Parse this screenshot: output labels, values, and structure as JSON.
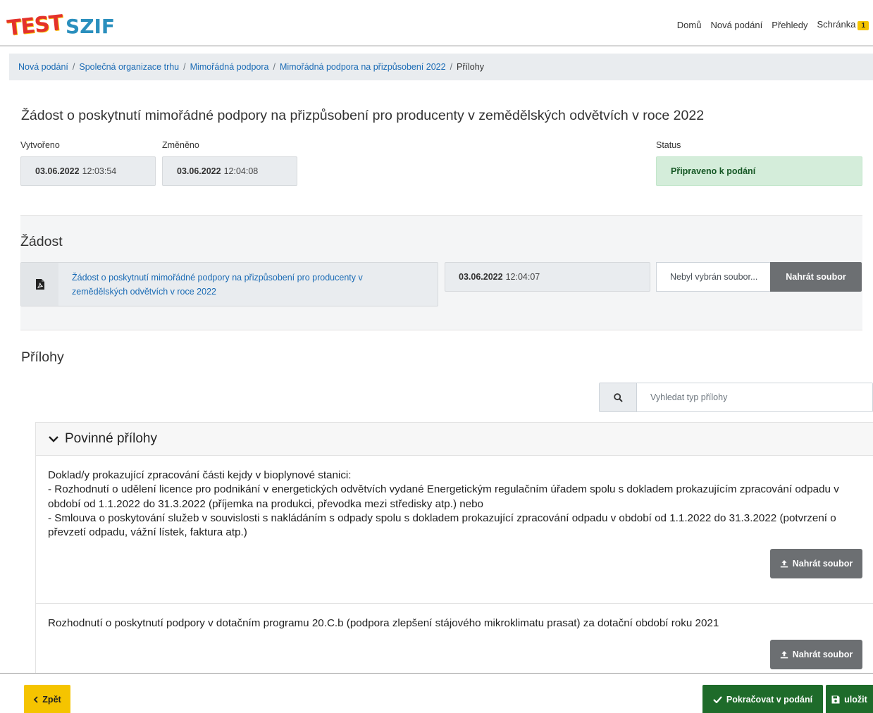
{
  "header": {
    "logo_test": "TEST",
    "logo_szif": "SZIF",
    "nav": [
      "Domů",
      "Nová podání",
      "Přehledy",
      "Schránka"
    ],
    "inbox_count": "1"
  },
  "breadcrumb": {
    "items": [
      "Nová podání",
      "Společná organizace trhu",
      "Mimořádná podpora",
      "Mimořádná podpora na přizpůsobení 2022"
    ],
    "separator": "/",
    "current": "Přílohy"
  },
  "page_title": "Žádost o poskytnutí mimořádné podpory na přizpůsobení pro producenty v zemědělských odvětvích v roce 2022",
  "meta": {
    "created_label": "Vytvořeno",
    "created_date": "03.06.2022",
    "created_time": "12:03:54",
    "changed_label": "Změněno",
    "changed_date": "03.06.2022",
    "changed_time": "12:04:08",
    "status_label": "Status",
    "status_value": "Připraveno k podání"
  },
  "zadost": {
    "title": "Žádost",
    "doc_link": "Žádost o poskytnutí mimořádné podpory na přizpůsobení pro producenty v zemědělských odvětvích v roce 2022",
    "doc_date": "03.06.2022",
    "doc_time": "12:04:07",
    "file_placeholder": "Nebyl vybrán soubor...",
    "upload_label": "Nahrát soubor"
  },
  "prilohy": {
    "title": "Přílohy",
    "search_placeholder": "Vyhledat typ přílohy",
    "panel_title": "Povinné přílohy",
    "items": [
      {
        "lines": [
          "Doklad/y prokazující zpracování části kejdy v bioplynové stanici:",
          "- Rozhodnutí o udělení licence pro podnikání v energetických odvětvích vydané Energetickým regulačním úřadem spolu s dokladem prokazujícím zpracování odpadu v období od 1.1.2022 do 31.3.2022 (příjemka na produkci, převodka mezi středisky atp.) nebo",
          "- Smlouva o poskytování služeb v souvislosti s nakládáním s odpady spolu s dokladem prokazující zpracování odpadu v období od 1.1.2022 do 31.3.2022 (potvrzení o převzetí odpadu, vážní lístek, faktura atp.)"
        ],
        "upload_label": "Nahrát soubor"
      },
      {
        "text": "Rozhodnutí o poskytnutí podpory v dotačním programu 20.C.b (podpora zlepšení stájového mikroklimatu prasat) za dotační období roku 2021",
        "upload_label": "Nahrát soubor"
      }
    ]
  },
  "footer": {
    "back_label": "Zpět",
    "continue_label": "Pokračovat v podání",
    "save_label": "uložit"
  }
}
